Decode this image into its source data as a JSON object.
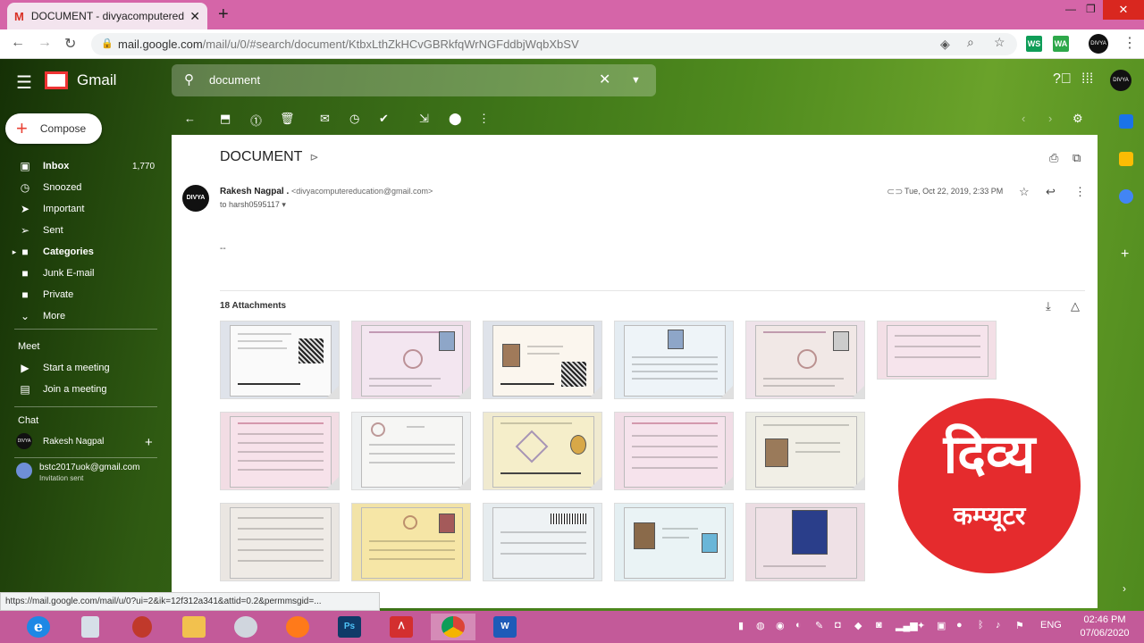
{
  "browser": {
    "tab_title": "DOCUMENT - divyacomputereducation",
    "tab_icon": "M",
    "url_main": "mail.google.com",
    "url_rest": "/mail/u/0/#search/document/KtbxLthZkHCvGBRkfqWrNGFddbjWqbXbSV",
    "extensions": [
      "WS",
      "WA"
    ],
    "profile_label": "DIVYA"
  },
  "gmail": {
    "app_name": "Gmail",
    "search_query": "document",
    "header_profile_label": "DIVYA",
    "compose_label": "Compose",
    "nav": [
      {
        "label": "Inbox",
        "count": "1,770",
        "icon": "inbox-icon",
        "glyph": "▣"
      },
      {
        "label": "Snoozed",
        "count": "",
        "icon": "clock-icon",
        "glyph": "◷"
      },
      {
        "label": "Important",
        "count": "",
        "icon": "important-icon",
        "glyph": "➤"
      },
      {
        "label": "Sent",
        "count": "",
        "icon": "send-icon",
        "glyph": "➢"
      },
      {
        "label": "Categories",
        "count": "",
        "icon": "label-icon",
        "glyph": "▸"
      },
      {
        "label": "Junk E-mail",
        "count": "",
        "icon": "label-icon",
        "glyph": "■"
      },
      {
        "label": "Private",
        "count": "",
        "icon": "label-icon",
        "glyph": "■"
      },
      {
        "label": "More",
        "count": "",
        "icon": "chevron-down-icon",
        "glyph": "⌄"
      }
    ],
    "meet": {
      "title": "Meet",
      "start": "Start a meeting",
      "join": "Join a meeting"
    },
    "chat": {
      "title": "Chat",
      "user": "Rakesh Nagpal",
      "invite_email": "bstc2017uok@gmail.com",
      "invite_status": "Invitation sent"
    }
  },
  "message": {
    "subject": "DOCUMENT",
    "sender_name": "Rakesh Nagpal .",
    "sender_email": "<divyacomputereducation@gmail.com>",
    "to_line": "to harsh0595117",
    "date": "Tue, Oct 22, 2019, 2:33 PM",
    "body": "--",
    "attachments_label": "18 Attachments",
    "avatar_label": "DIVYA"
  },
  "logo_overlay": {
    "line1": "दिव्य",
    "line2": "कम्प्यूटर"
  },
  "status_url": "https://mail.google.com/mail/u/0?ui=2&ik=12f312a341&attid=0.2&permmsgid=...",
  "taskbar": {
    "apps": [
      "ie",
      "calculator",
      "snipping-tool",
      "file-explorer",
      "media",
      "firefox",
      "photoshop",
      "acrobat",
      "chrome",
      "word"
    ],
    "ps_label": "Ps",
    "word_label": "W",
    "lang": "ENG",
    "time": "02:46 PM",
    "date": "07/06/2020"
  }
}
